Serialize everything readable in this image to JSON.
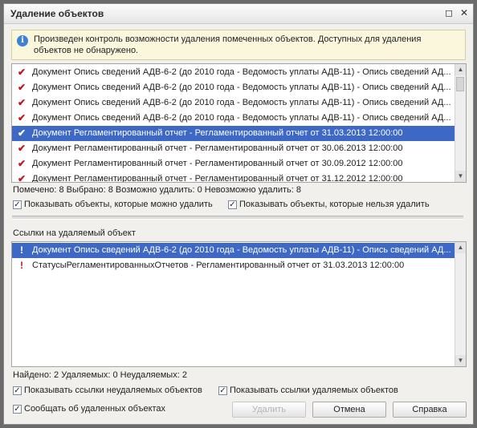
{
  "window": {
    "title": "Удаление объектов",
    "maximize_glyph": "◻",
    "close_glyph": "✕"
  },
  "info": {
    "icon": "info-icon",
    "text": "Произведен контроль возможности удаления помеченных объектов. Доступных для удаления объектов не обнаружено."
  },
  "objects": {
    "rows": [
      {
        "label": "Документ Опись сведений АДВ-6-2 (до 2010 года - Ведомость уплаты АДВ-11) - Опись сведений АД..."
      },
      {
        "label": "Документ Опись сведений АДВ-6-2 (до 2010 года - Ведомость уплаты АДВ-11) - Опись сведений АД..."
      },
      {
        "label": "Документ Опись сведений АДВ-6-2 (до 2010 года - Ведомость уплаты АДВ-11) - Опись сведений АД..."
      },
      {
        "label": "Документ Опись сведений АДВ-6-2 (до 2010 года - Ведомость уплаты АДВ-11) - Опись сведений АД..."
      },
      {
        "label": "Документ Регламентированный отчет - Регламентированный отчет от 31.03.2013 12:00:00"
      },
      {
        "label": "Документ Регламентированный отчет - Регламентированный отчет от 30.06.2013 12:00:00"
      },
      {
        "label": "Документ Регламентированный отчет - Регламентированный отчет от 30.09.2012 12:00:00"
      },
      {
        "label": "Документ Регламентированный отчет - Регламентированный отчет от 31.12.2012 12:00:00"
      }
    ],
    "selected_index": 4,
    "marker": "✔"
  },
  "stats1": "Помечено: 8  Выбрано: 8  Возможно удалить: 0  Невозможно удалить: 8",
  "check_show_deletable": {
    "label": "Показывать объекты, которые можно удалить",
    "checked": true
  },
  "check_show_nondeletable": {
    "label": "Показывать объекты, которые нельзя удалить",
    "checked": true
  },
  "refs_title": "Ссылки на удаляемый объект",
  "refs": {
    "rows": [
      {
        "label": "Документ Опись сведений АДВ-6-2 (до 2010 года - Ведомость уплаты АДВ-11) - Опись сведений АД..."
      },
      {
        "label": "СтатусыРегламентированныхОтчетов  - Регламентированный отчет от 31.03.2013 12:00:00"
      }
    ],
    "selected_index": 0,
    "marker": "!"
  },
  "stats2": "Найдено: 2  Удаляемых: 0  Неудаляемых: 2",
  "check_show_nondeletable_refs": {
    "label": "Показывать ссылки неудаляемых объектов",
    "checked": true
  },
  "check_show_deletable_refs": {
    "label": "Показывать ссылки удаляемых объектов",
    "checked": true
  },
  "check_report_deleted": {
    "label": "Сообщать об удаленных объектах",
    "checked": true
  },
  "buttons": {
    "delete": "Удалить",
    "cancel": "Отмена",
    "help": "Справка"
  },
  "check_glyph": "✓",
  "scroll_up_glyph": "▲",
  "scroll_down_glyph": "▼"
}
